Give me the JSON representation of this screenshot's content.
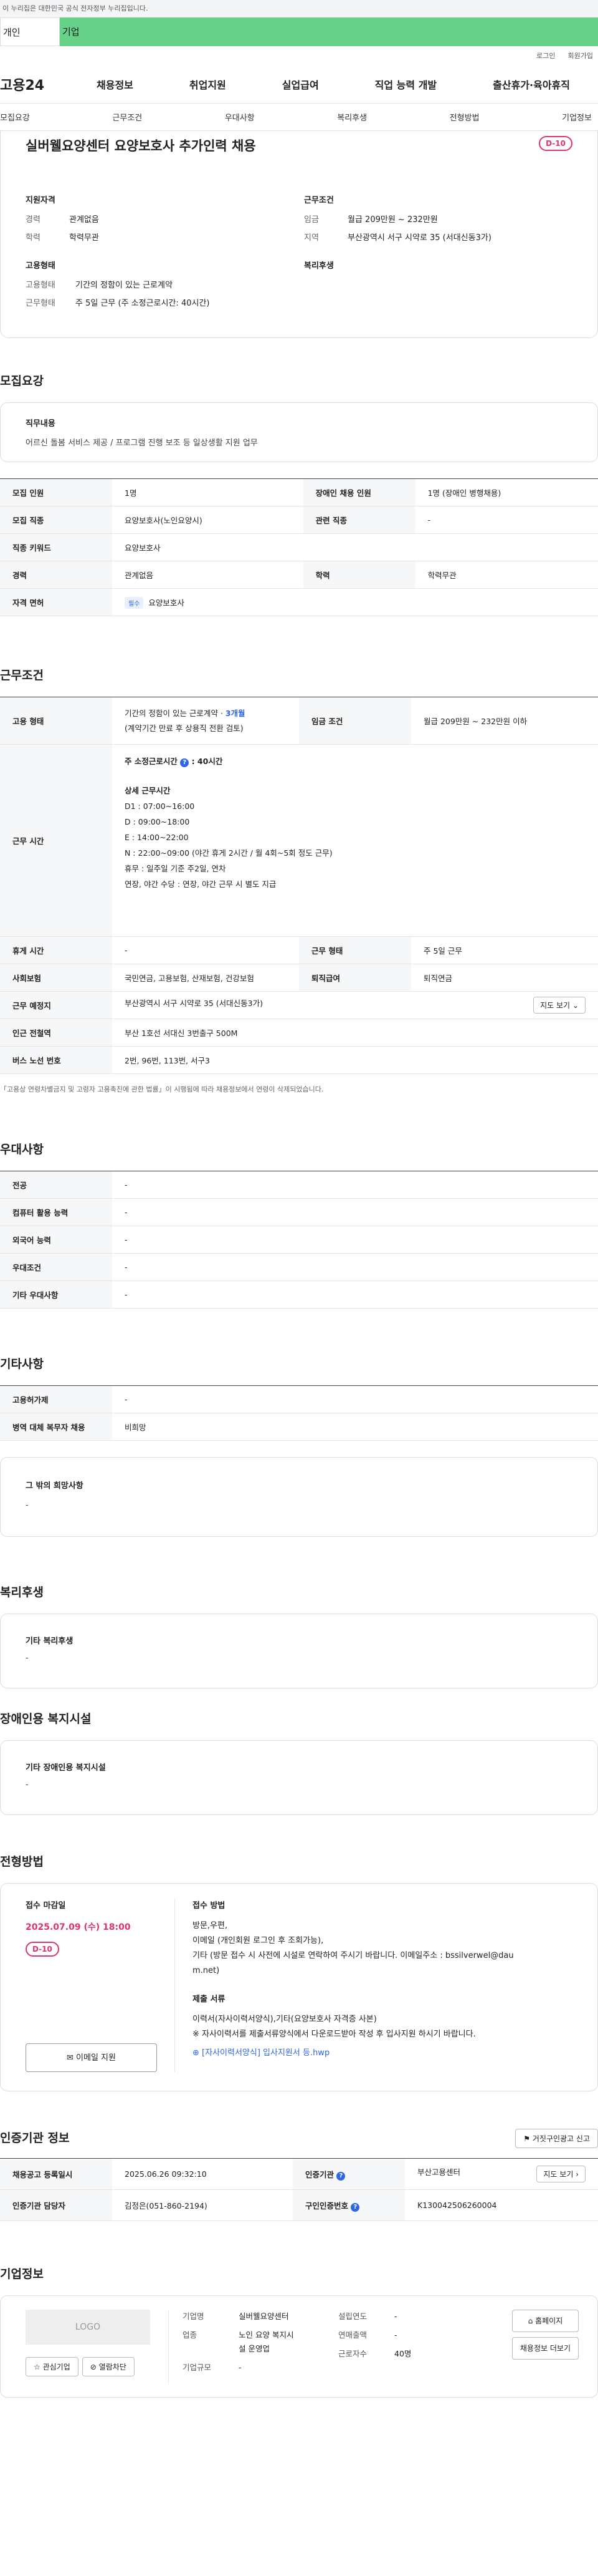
{
  "gov_banner": "이 누리집은 대한민국 공식 전자정부 누리집입니다.",
  "top_tabs": [
    "개인",
    "기업"
  ],
  "util": [
    "로그인",
    "회원가입"
  ],
  "logo": "고용24",
  "gnb": [
    "채용정보",
    "취업지원",
    "실업급여",
    "직업 능력 개발",
    "출산휴가·육아휴직"
  ],
  "snb": [
    "모집요강",
    "근무조건",
    "우대사항",
    "복리후생",
    "전형방법",
    "기업정보"
  ],
  "job": {
    "title": "실버웰요양센터 요양보호사 추가인력 채용",
    "dday": "D-10",
    "qual_title": "지원자격",
    "qual": [
      {
        "k": "경력",
        "v": "관계없음"
      },
      {
        "k": "학력",
        "v": "학력무관"
      }
    ],
    "cond_title": "근무조건",
    "cond": [
      {
        "k": "임금",
        "v": "월급 209만원 ~ 232만원"
      },
      {
        "k": "지역",
        "v": "부산광역시 서구 시약로 35 (서대신동3가)"
      }
    ],
    "emp_title": "고용형태",
    "emp": [
      {
        "k": "고용형태",
        "v": "기간의 정함이 있는 근로계약"
      },
      {
        "k": "근무형태",
        "v": "주 5일 근무 (주 소정근로시간: 40시간)"
      }
    ],
    "welfare_title": "복리후생"
  },
  "recruit": {
    "title": "모집요강",
    "duty_label": "직무내용",
    "duty": "어르신 돌봄 서비스 제공 / 프로그램 진행 보조 등 일상생활 지원 업무",
    "rows": {
      "headcount_k": "모집 인원",
      "headcount_v": "1명",
      "disabled_k": "장애인 채용 인원",
      "disabled_v": "1명 (장애인 병행채용)",
      "job_k": "모집 직종",
      "job_v": "요양보호사(노인요양시)",
      "related_k": "관련 직종",
      "related_v": "-",
      "keyword_k": "직종 키워드",
      "keyword_v": "요양보호사",
      "career_k": "경력",
      "career_v": "관계없음",
      "edu_k": "학력",
      "edu_v": "학력무관",
      "license_k": "자격 면허",
      "license_tag": "필수",
      "license_v": "요양보호사"
    }
  },
  "workcond": {
    "title": "근무조건",
    "emp_k": "고용 형태",
    "emp_v1": "기간의 정함이 있는 근로계약 · ",
    "emp_v1b": "3개월",
    "emp_v2": "(계약기간 만료 후 상용직 전환 검토)",
    "wage_k": "임금 조건",
    "wage_v": "월급 209만원 ~ 232만원 이하",
    "hours_k": "근무 시간",
    "hours_a": "주 소정근로시간",
    "hours_a_icon": "?",
    "hours_b": ": 40시간",
    "detail_title": "상세 근무시간",
    "detail": [
      "D1 : 07:00~16:00",
      "D : 09:00~18:00",
      "E : 14:00~22:00",
      "N : 22:00~09:00 (야간 휴게 2시간 / 월 4회~5회 정도 근무)",
      "휴무 : 일주일 기준 주2일, 연차",
      "연장, 야간 수당 : 연장, 야간 근무 시 별도 지급"
    ],
    "break_k": "휴게 시간",
    "break_v": "-",
    "form_k": "근무 형태",
    "form_v": "주 5일 근무",
    "insur_k": "사회보험",
    "insur_v": "국민연금, 고용보험, 산재보험, 건강보험",
    "retire_k": "퇴직급여",
    "retire_v": "퇴직연금",
    "place_k": "근무 예정지",
    "place_v": "부산광역시 서구 시약로 35 (서대신동3가)",
    "map_btn": "지도 보기",
    "subway_k": "인근 전철역",
    "subway_v": "부산 1호선 서대신 3번출구 500M",
    "bus_k": "버스 노선 번호",
    "bus_v": "2번, 96번, 113번, 서구3",
    "note": "「고용상 연령차별금지 및 고령자 고용촉진에 관한 법률」이 시행됨에 따라 채용정보에서 연령이 삭제되었습니다."
  },
  "pref": {
    "title": "우대사항",
    "rows": [
      {
        "k": "전공",
        "v": "-"
      },
      {
        "k": "컴퓨터 활용 능력",
        "v": "-"
      },
      {
        "k": "외국어 능력",
        "v": "-"
      },
      {
        "k": "우대조건",
        "v": "-"
      },
      {
        "k": "기타 우대사항",
        "v": "-"
      }
    ]
  },
  "etc": {
    "title": "기타사항",
    "rows": [
      {
        "k": "고용허가제",
        "v": "-"
      },
      {
        "k": "병역 대체 복무자 채용",
        "v": "비희망"
      }
    ],
    "other_label": "그 밖의 희망사항",
    "other_v": "-"
  },
  "welfare": {
    "title": "복리후생",
    "label": "기타 복리후생",
    "v": "-"
  },
  "facility": {
    "title": "장애인용 복지시설",
    "label": "기타 장애인용 복지시설",
    "v": "-"
  },
  "screening": {
    "title": "전형방법",
    "deadline_label": "접수 마감일",
    "deadline": "2025.07.09 (수) 18:00",
    "dday": "D-10",
    "email_btn": "이메일 지원",
    "method_label": "접수 방법",
    "method": [
      "방문,우편,",
      "이메일 (개인회원 로그인 후 조회가능),",
      "기타 (방문 접수 시 사전에 시설로 연락하여 주시기 바랍니다. 이메일주소 : bssilverwel@dau",
      "m.net)"
    ],
    "docs_label": "제출 서류",
    "docs": [
      "이력서(자사이력서양식),기타(요양보호사 자격증 사본)",
      "※ 자사이력서를 제출서류양식에서 다운로드받아 작성 후 입사지원 하시기 바랍니다."
    ],
    "file": "[자사이력서양식] 입사지원서 등.hwp"
  },
  "certify": {
    "title": "인증기관 정보",
    "report_btn": "거짓구인광고 신고",
    "reg_k": "채용공고 등록일시",
    "reg_v": "2025.06.26 09:32:10",
    "org_k": "인증기관",
    "org_v": "부산고용센터",
    "org_btn": "지도 보기",
    "mgr_k": "인증기관 담당자",
    "mgr_v": "김정은(051-860-2194)",
    "no_k": "구인인증번호",
    "no_v": "K130042506260004"
  },
  "company": {
    "title": "기업정보",
    "logo": "LOGO",
    "fav_btn": "관심기업",
    "block_btn": "열람차단",
    "name_k": "기업명",
    "name_v": "실버웰요양센터",
    "year_k": "설립연도",
    "year_v": "-",
    "ind_k": "업종",
    "ind_v1": "노인 요양 복지시",
    "ind_v2": "설 운영업",
    "sales_k": "연매출액",
    "sales_v": "-",
    "emp_k": "근로자수",
    "emp_v": "40명",
    "size_k": "기업규모",
    "size_v": "-",
    "home_btn": "홈페이지",
    "more_btn": "채용정보 더보기"
  }
}
